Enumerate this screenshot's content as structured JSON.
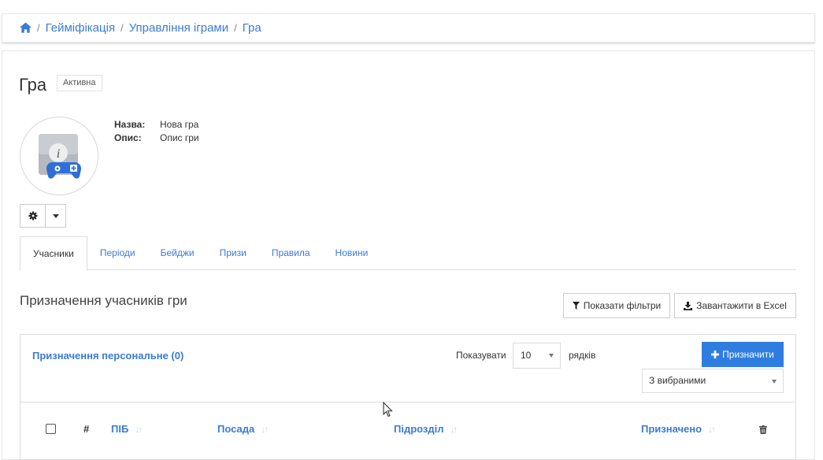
{
  "breadcrumb": {
    "items": [
      "Гейміфікація",
      "Управління іграми",
      "Гра"
    ],
    "separator": "/"
  },
  "page": {
    "title": "Гра",
    "status": "Активна"
  },
  "info": {
    "name_label": "Назва:",
    "name_value": "Нова гра",
    "desc_label": "Опис:",
    "desc_value": "Опис гри"
  },
  "tabs": [
    {
      "label": "Учасники",
      "active": true
    },
    {
      "label": "Періоди"
    },
    {
      "label": "Бейджи"
    },
    {
      "label": "Призи"
    },
    {
      "label": "Правила"
    },
    {
      "label": "Новини"
    }
  ],
  "section": {
    "title": "Призначення учасників гри",
    "filter_button": "Показати фільтри",
    "excel_button": "Завантажити в Excel"
  },
  "panel": {
    "title": "Призначення персональне (0)",
    "show_label": "Показувати",
    "page_length": "10",
    "rows_label": "рядків",
    "assign_button": "Призначити",
    "bulk_action": "З вибраними"
  },
  "table": {
    "columns": [
      "#",
      "ПІБ",
      "Посада",
      "Підрозділ",
      "Призначено"
    ]
  },
  "colors": {
    "link": "#3a7bd5",
    "primary_button": "#2f7de0",
    "border": "#dddddd"
  },
  "icons": [
    "home-icon",
    "gear-icon",
    "caret-down-icon",
    "filter-icon",
    "download-icon",
    "plus-icon",
    "sort-icon",
    "trash-icon",
    "game-info-icon",
    "mouse-cursor-icon"
  ]
}
